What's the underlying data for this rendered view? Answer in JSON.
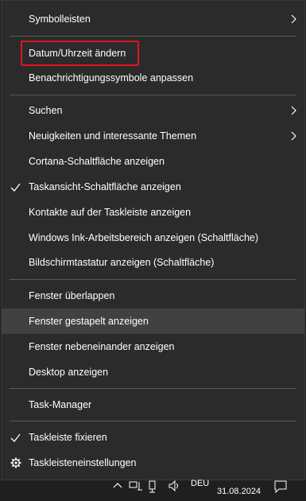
{
  "menu": {
    "toolbars": "Symbolleisten",
    "adjust_datetime": "Datum/Uhrzeit ändern",
    "notification_icons": "Benachrichtigungssymbole anpassen",
    "search": "Suchen",
    "news_interests": "Neuigkeiten und interessante Themen",
    "cortana_button": "Cortana-Schaltfläche anzeigen",
    "task_view_button": "Taskansicht-Schaltfläche anzeigen",
    "contacts": "Kontakte auf der Taskleiste anzeigen",
    "ink_workspace": "Windows Ink-Arbeitsbereich anzeigen (Schaltfläche)",
    "touch_keyboard": "Bildschirmtastatur anzeigen (Schaltfläche)",
    "cascade": "Fenster überlappen",
    "stacked": "Fenster gestapelt anzeigen",
    "side_by_side": "Fenster nebeneinander anzeigen",
    "show_desktop": "Desktop anzeigen",
    "task_manager": "Task-Manager",
    "lock_taskbar": "Taskleiste fixieren",
    "taskbar_settings": "Taskleisteneinstellungen"
  },
  "taskbar": {
    "language": "DEU",
    "date": "31.08.2024"
  },
  "icons": {
    "submenu": "chevron-right-icon",
    "checked": "checkmark-icon",
    "settings": "gear-icon",
    "tray_up": "chevron-up-icon",
    "network": "network-icon",
    "volume": "speaker-icon",
    "notifications": "notification-icon"
  },
  "colors": {
    "menu_bg": "#2b2b2b",
    "hover_bg": "#414141",
    "highlight_border": "#e0141e",
    "text": "#ffffff"
  }
}
